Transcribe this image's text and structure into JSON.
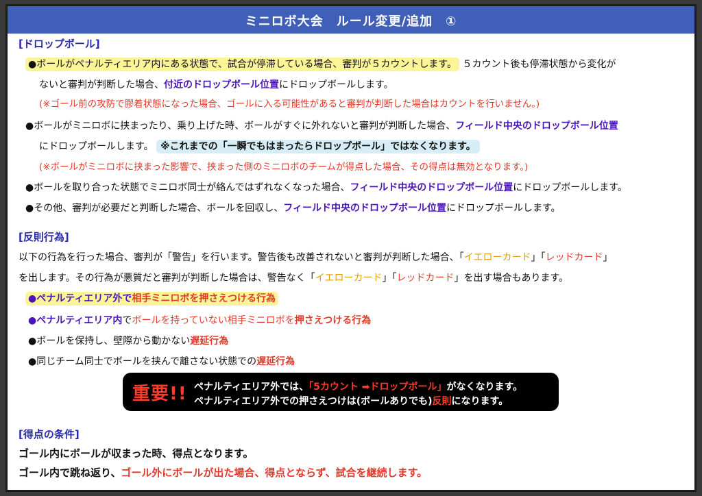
{
  "title": "ミニロボ大会　ルール変更/追加　①",
  "drop": {
    "heading": "[ドロップボール]",
    "l1_hl": "●ボールがペナルティエリア内にある状態で、試合が停滞している場合、審判が５カウントします。",
    "l1_rest": "５カウント後も停滞状態から変化が",
    "l2a": "ないと審判が判断した場合、",
    "l2b": "付近のドロップボール位置",
    "l2c": "にドロップボールします。",
    "l3": "(※ゴール前の攻防で膠着状態になった場合、ゴールに入る可能性があると審判が判断した場合はカウントを行いません。)",
    "l4a": "●ボールがミニロボに挟まったり、乗り上げた時、ボールがすぐに外れないと審判が判断した場合、",
    "l4b": "フィールド中央のドロップボール位置",
    "l5a": "にドロップボールします。",
    "l5b": "※これまでの「一瞬でもはまったらドロップボール」ではなくなります。",
    "l6": "(※ボールがミニロボに挟まった影響で、挟まった側のミニロボのチームが得点した場合、その得点は無効となります。)",
    "l7a": "●ボールを取り合った状態でミニロボ同士が絡んではずれなくなった場合、",
    "l7b": "フィールド中央のドロップボール位置",
    "l7c": "にドロップボールします。",
    "l8a": "●その他、審判が必要だと判断した場合、ボールを回収し、",
    "l8b": "フィールド中央のドロップボール位置",
    "l8c": "にドロップボールします。"
  },
  "foul": {
    "heading": "[反則行為]",
    "p1a": "以下の行為を行った場合、審判が「警告」を行います。警告後も改善されないと審判が判断した場合、「",
    "yellow": "イエローカード",
    "mid": "」「",
    "red": "レッドカード",
    "p1end": "」",
    "p2a": "を出します。その行為が悪質だと審判が判断した場合は、警告なく「",
    "p2b": "」「",
    "p2c": "」を出す場合もあります。",
    "b1a": "●ペナルティエリア外で",
    "b1b": "相手ミニロボを押さえつける行為",
    "b2a": "●ペナルティエリア内",
    "b2b": "で",
    "b2c": "ボールを持っていない相手ミニロボを",
    "b2d": "押さえつける行為",
    "b3a": "●ボールを保持し、壁際から動かない",
    "b3b": "遅延行為",
    "b4a": "●同じチーム同士でボールを挟んで離さない状態での",
    "b4b": "遅延行為"
  },
  "alert": {
    "big": "重要!!",
    "l1a": "ペナルティエリア外では、",
    "l1b": "「5カウント ➡ドロップボール」",
    "l1c": "がなくなります。",
    "l2a": "ペナルティエリア外での押さえつけは(ボールありでも)",
    "l2b": "反則",
    "l2c": "になります。"
  },
  "score": {
    "heading": "[得点の条件]",
    "l1": "ゴール内にボールが収まった時、得点となります。",
    "l2a": "ゴール内で跳ね返り、",
    "l2b": "ゴール外にボールが出た場合、得点とならず、試合を継続します。"
  }
}
